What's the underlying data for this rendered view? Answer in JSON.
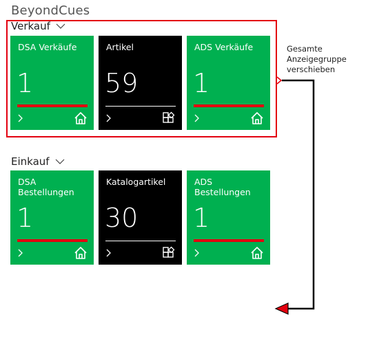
{
  "app": {
    "title": "BeyondCues"
  },
  "groups": [
    {
      "name": "Verkauf",
      "tiles": [
        {
          "title": "DSA Verkäufe",
          "value": "1",
          "style": "green",
          "icon": "home-icon"
        },
        {
          "title": "Artikel",
          "value": "59",
          "style": "black",
          "icon": "grid-add-icon"
        },
        {
          "title": "ADS Verkäufe",
          "value": "1",
          "style": "green",
          "icon": "home-icon"
        }
      ]
    },
    {
      "name": "Einkauf",
      "tiles": [
        {
          "title": "DSA Bestellungen",
          "value": "1",
          "style": "green",
          "icon": "home-icon"
        },
        {
          "title": "Katalogartikel",
          "value": "30",
          "style": "black",
          "icon": "grid-add-icon"
        },
        {
          "title": "ADS Bestellungen",
          "value": "1",
          "style": "green",
          "icon": "home-icon"
        }
      ]
    }
  ],
  "annotation": {
    "text": "Gesamte Anzeigegruppe verschieben"
  },
  "colors": {
    "tile_green": "#00b050",
    "tile_black": "#000000",
    "accent_red": "#e3000f"
  }
}
